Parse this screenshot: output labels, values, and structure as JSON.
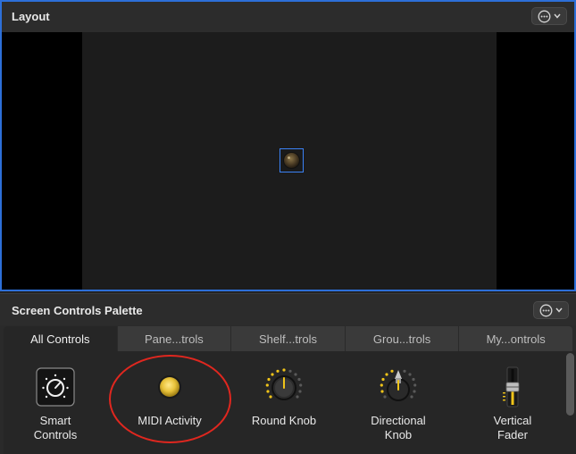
{
  "layout": {
    "title": "Layout",
    "menu_icon": "ellipsis-circle-icon"
  },
  "palette": {
    "title": "Screen Controls Palette",
    "menu_icon": "ellipsis-circle-icon",
    "tabs": [
      {
        "label": "All Controls",
        "active": true
      },
      {
        "label": "Pane...trols",
        "active": false
      },
      {
        "label": "Shelf...trols",
        "active": false
      },
      {
        "label": "Grou...trols",
        "active": false
      },
      {
        "label": "My...ontrols",
        "active": false
      }
    ],
    "items": [
      {
        "label": "Smart\nControls",
        "icon": "smart-controls-icon"
      },
      {
        "label": "MIDI Activity",
        "icon": "midi-activity-icon"
      },
      {
        "label": "Round Knob",
        "icon": "round-knob-icon"
      },
      {
        "label": "Directional\nKnob",
        "icon": "directional-knob-icon"
      },
      {
        "label": "Vertical\nFader",
        "icon": "vertical-fader-icon"
      }
    ]
  },
  "colors": {
    "selection": "#2d6fd8",
    "accent_led": "#f0c419",
    "annotation": "#e0271f"
  }
}
